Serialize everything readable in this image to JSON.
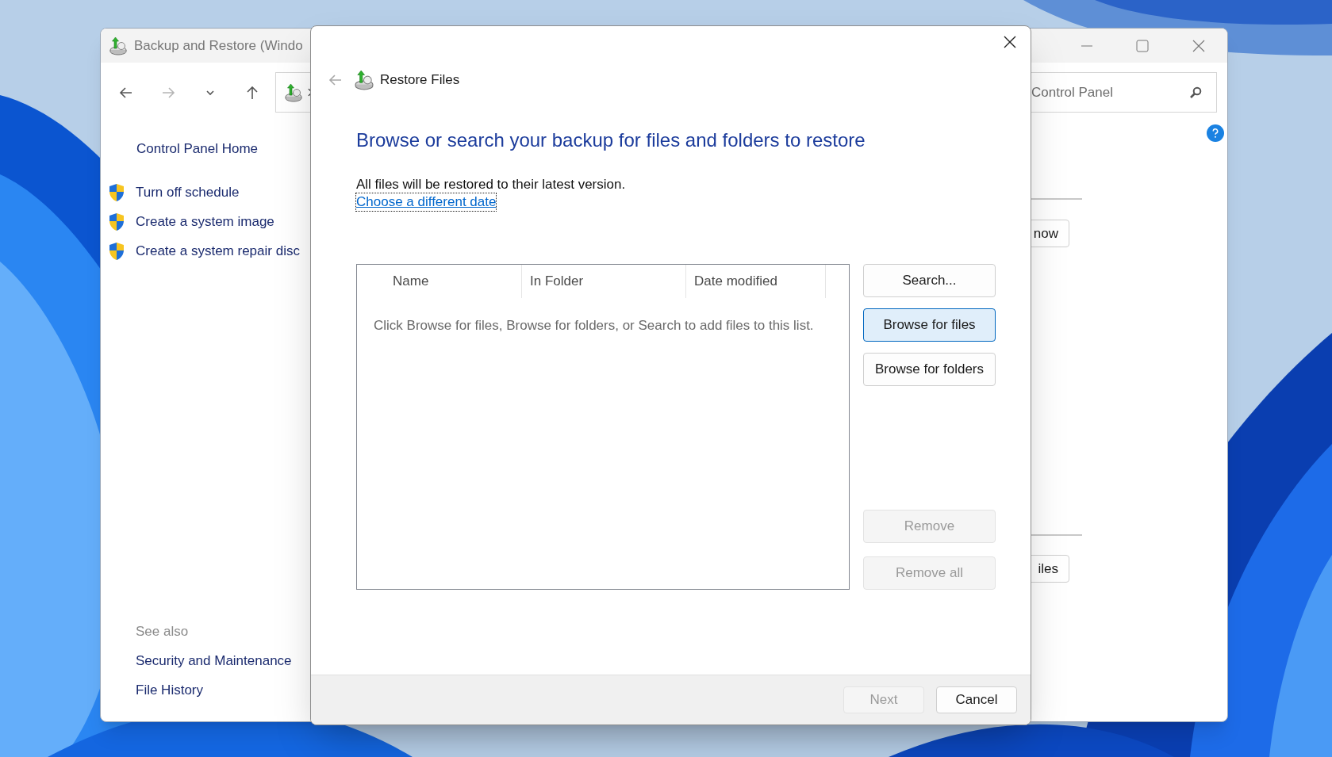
{
  "background_window": {
    "title": "Backup and Restore (Windo",
    "nav_buttons": [
      {
        "kind": "back",
        "disabled": false
      },
      {
        "kind": "forward",
        "disabled": true
      },
      {
        "kind": "recent",
        "disabled": false
      },
      {
        "kind": "up",
        "disabled": false
      }
    ],
    "search": {
      "placeholder": "Control Panel"
    },
    "sidebar": {
      "home": "Control Panel Home",
      "tasks": [
        "Turn off schedule",
        "Create a system image",
        "Create a system repair disc"
      ],
      "see_also_heading": "See also",
      "see_also": [
        "Security and Maintenance",
        "File History"
      ]
    },
    "buttons": [
      "now",
      "iles"
    ]
  },
  "dialog": {
    "back_disabled": true,
    "title": "Restore Files",
    "heading": "Browse or search your backup for files and folders to restore",
    "info": "All files will be restored to their latest version.",
    "link": {
      "label": "Choose a different date",
      "focused": true
    },
    "file_list": {
      "columns": [
        "Name",
        "In Folder",
        "Date modified"
      ],
      "empty_message": "Click Browse for files, Browse for folders, or Search to add files to this list."
    },
    "action_buttons": [
      {
        "label": "Search...",
        "selected": false,
        "disabled": false
      },
      {
        "label": "Browse for files",
        "selected": true,
        "disabled": false
      },
      {
        "label": "Browse for folders",
        "selected": false,
        "disabled": false
      }
    ],
    "remove_buttons": [
      {
        "label": "Remove",
        "disabled": true
      },
      {
        "label": "Remove all",
        "disabled": true
      }
    ],
    "footer_buttons": [
      {
        "label": "Next",
        "disabled": true
      },
      {
        "label": "Cancel",
        "disabled": false
      }
    ]
  }
}
